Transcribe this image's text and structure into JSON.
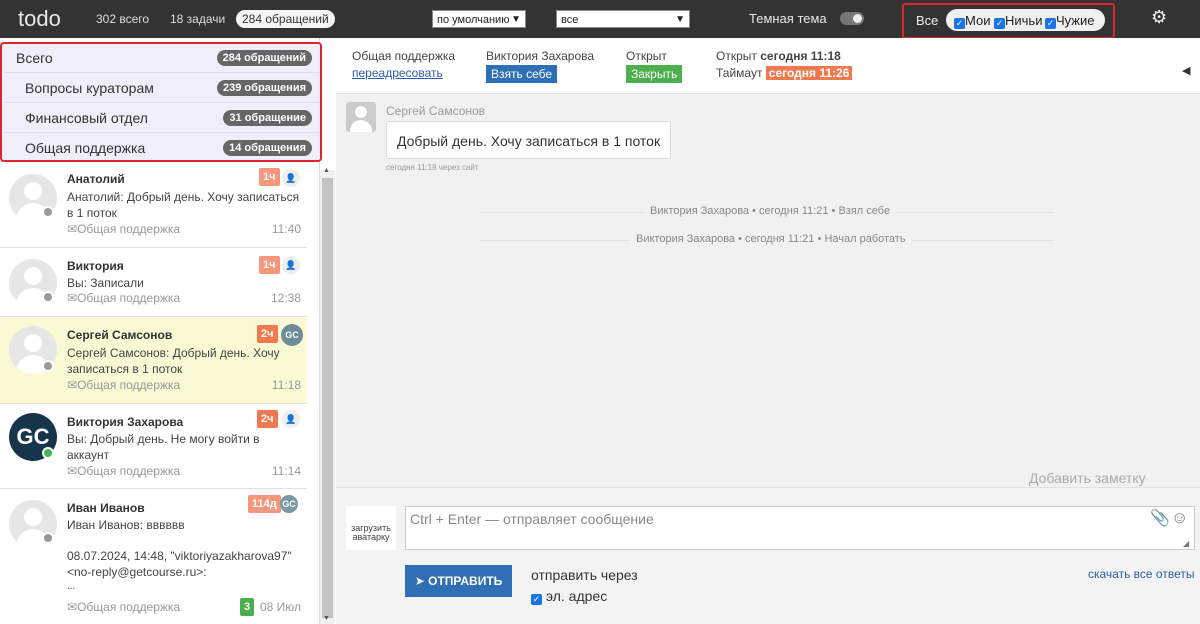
{
  "topbar": {
    "logo": "todo",
    "total_label": "302 всего",
    "tasks_label": "18 задачи",
    "requests_label": "284 обращений",
    "sort_select": "по умолчанию",
    "filter_select": "все",
    "dark_theme_label": "Темная тема",
    "filter_all_label": "Все",
    "filter_mine": "Мои",
    "filter_nobody": "Ничьи",
    "filter_others": "Чужие"
  },
  "categories": [
    {
      "name": "Всего",
      "badge": "284 обращений"
    },
    {
      "name": "Вопросы кураторам",
      "badge": "239 обращения"
    },
    {
      "name": "Финансовый отдел",
      "badge": "31 обращение"
    },
    {
      "name": "Общая поддержка",
      "badge": "14 обращения"
    }
  ],
  "dialogs": [
    {
      "name": "Анатолий",
      "text": "Анатолий: Добрый день. Хочу записаться в 1 поток",
      "source": "Общая поддержка",
      "time": "11:40",
      "age": "1ч"
    },
    {
      "name": "Виктория",
      "text": "Вы: Записали",
      "source": "Общая поддержка",
      "time": "12:38",
      "age": "1ч"
    },
    {
      "name": "Сергей Самсонов",
      "text": "Сергей Самсонов: Добрый день. Хочу записаться в 1 поток",
      "source": "Общая поддержка",
      "time": "11:18",
      "age": "2ч",
      "agent": "GC"
    },
    {
      "name": "Виктория Захарова",
      "text": "Вы: Добрый день. Не могу войти в аккаунт",
      "source": "Общая поддержка",
      "time": "11:14",
      "age": "2ч",
      "avatar_text": "GC"
    },
    {
      "name": "Иван Иванов",
      "text": "Иван Иванов: вввввв",
      "extra1": "08.07.2024, 14:48, \"viktoriyazakharova97\"",
      "extra2": "<no-reply@getcourse.ru>:",
      "extra3": "...",
      "source": "Общая поддержка",
      "time": "08 Июл",
      "age": "114д",
      "count": "3",
      "agent": "GC"
    }
  ],
  "header": {
    "department": "Общая поддержка",
    "forward_link": "переадресовать",
    "assignee": "Виктория Захарова",
    "take_button": "Взять себе",
    "status": "Открыт",
    "close_button": "Закрыть",
    "opened_prefix": "Открыт",
    "opened_value": "сегодня 11:18",
    "timeout_prefix": "Таймаут",
    "timeout_value": "сегодня 11:26"
  },
  "conversation": {
    "author": "Сергей Самсонов",
    "message": "Добрый день. Хочу записаться в 1 поток",
    "meta": "сегодня 11:18 через сайт",
    "system1": "Виктория Захарова • сегодня 11:21 • Взял себе",
    "system2": "Виктория Захарова • сегодня 11:21 • Начал работать",
    "add_note": "Добавить заметку"
  },
  "compose": {
    "upload_avatar": "загрузить аватарку",
    "placeholder": "Ctrl + Enter — отправляет сообщение",
    "send_button": "ОТПРАВИТЬ",
    "send_via": "отправить через",
    "email_option": "эл. адрес",
    "download_answers": "скачать все ответы"
  }
}
